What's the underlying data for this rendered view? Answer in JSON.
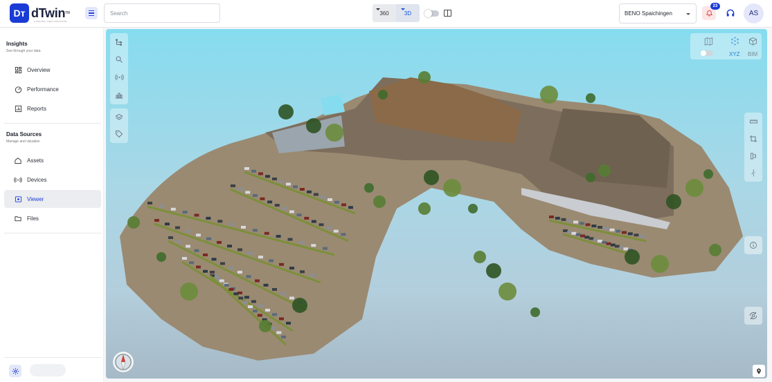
{
  "app": {
    "logo_mark": "Dт",
    "logo_name": "dTwin",
    "logo_tm": "TM",
    "logo_tagline": "A DIGITAL TWIN SOLUTION"
  },
  "header": {
    "menu_icon": "hamburger-icon",
    "search_placeholder": "Search",
    "view_modes": [
      {
        "label": "360",
        "active": false
      },
      {
        "label": "3D",
        "active": true
      }
    ],
    "split_view_icon": "split-view-icon",
    "site_select": {
      "value": "BENO Spaichingen"
    },
    "notifications": {
      "count": "23",
      "icon": "bell-icon"
    },
    "support_icon": "headset-icon",
    "user_initials": "AS"
  },
  "sidebar": {
    "sections": [
      {
        "title": "Insights",
        "subtitle": "See through your data",
        "items": [
          {
            "label": "Overview",
            "icon": "grid-icon",
            "active": false
          },
          {
            "label": "Performance",
            "icon": "gauge-icon",
            "active": false
          },
          {
            "label": "Reports",
            "icon": "report-icon",
            "active": false
          }
        ]
      },
      {
        "title": "Data Sources",
        "subtitle": "Manage and visualize",
        "items": [
          {
            "label": "Assets",
            "icon": "home-icon",
            "active": false
          },
          {
            "label": "Devices",
            "icon": "broadcast-icon",
            "active": false
          },
          {
            "label": "Viewer",
            "icon": "viewer-icon",
            "active": true
          },
          {
            "label": "Files",
            "icon": "folder-icon",
            "active": false
          }
        ]
      }
    ],
    "settings_icon": "gear-icon"
  },
  "viewer": {
    "left_tools": [
      "tree-icon",
      "search-icon",
      "sensor-icon",
      "chart-icon",
      "layers-icon",
      "tag-icon"
    ],
    "top_right_modes": [
      {
        "label": "",
        "icon": "map-icon"
      },
      {
        "label": "XYZ",
        "icon": "pointcloud-icon",
        "active": true
      },
      {
        "label": "BIM",
        "icon": "cube-icon"
      }
    ],
    "right_tools": [
      "ruler-icon",
      "crop-icon",
      "section-icon",
      "walk-icon"
    ],
    "info_icon": "info-icon",
    "orbit_icon": "orbit-icon",
    "compass_icon": "compass-icon",
    "location_icon": "location-pin-icon",
    "colors": {
      "sky_top": "#86dcef",
      "sky_bottom": "#a6b9c6",
      "accent": "#1a3bd6"
    }
  }
}
